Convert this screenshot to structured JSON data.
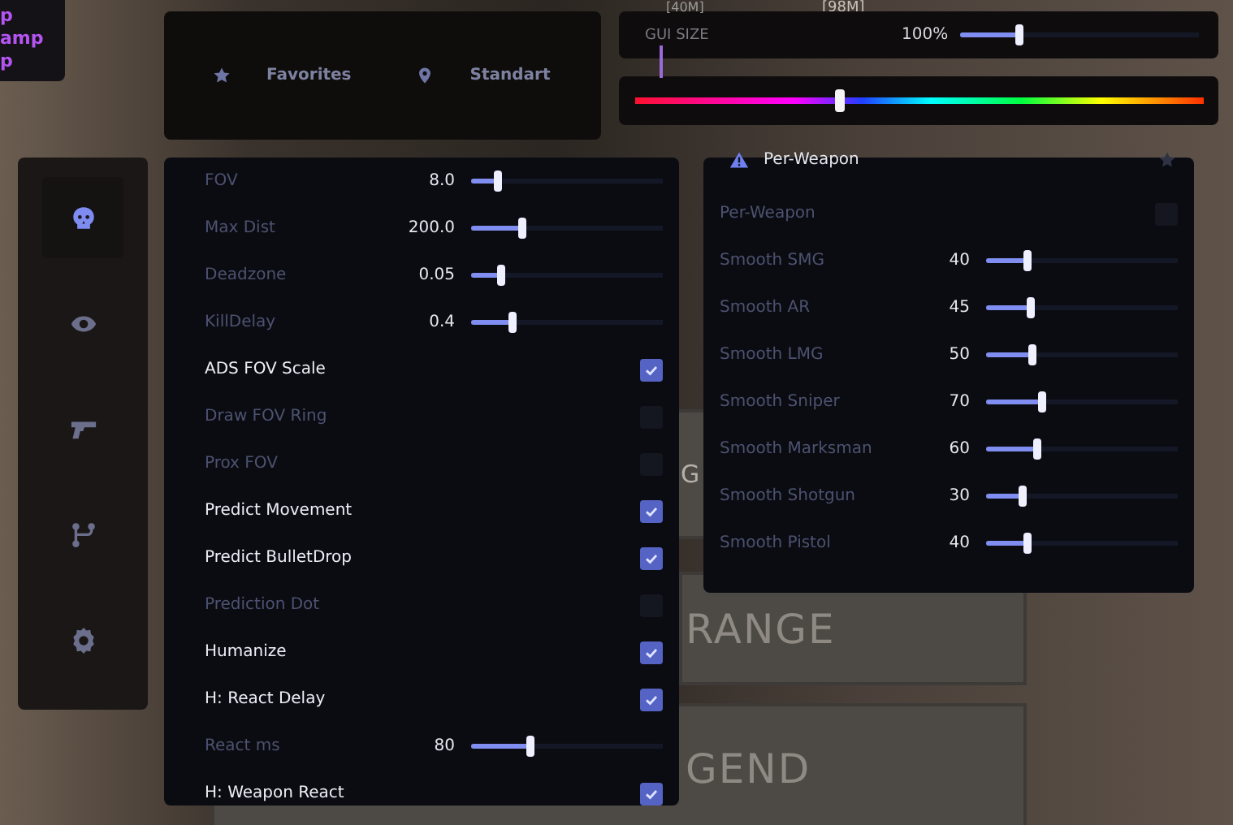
{
  "scene": {
    "distance_top": "[98M]",
    "distance_mid": "[40M]",
    "signs": [
      "G",
      "RANGE",
      "GEND"
    ]
  },
  "overlay_list": [
    "p",
    "amp",
    "p"
  ],
  "quick_bar": [
    {
      "label": "Favorites"
    },
    {
      "label": "Standart"
    }
  ],
  "gui_size": {
    "label": "GUI SIZE",
    "reading": "100%",
    "level": 0.24
  },
  "color_picker": {
    "level": 0.36
  },
  "sidebar": [
    {
      "selected": true
    },
    {
      "selected": false
    },
    {
      "selected": false
    },
    {
      "selected": false
    },
    {
      "selected": false
    }
  ],
  "settings": [
    {
      "kind": "slider",
      "label": "FOV",
      "reading": "8.0",
      "level": 0.13
    },
    {
      "kind": "slider",
      "label": "Max Dist",
      "reading": "200.0",
      "level": 0.25
    },
    {
      "kind": "slider",
      "label": "Deadzone",
      "reading": "0.05",
      "level": 0.14
    },
    {
      "kind": "slider",
      "label": "KillDelay",
      "reading": "0.4",
      "level": 0.2
    },
    {
      "kind": "checkbox",
      "label": "ADS FOV Scale",
      "checked": true
    },
    {
      "kind": "checkbox",
      "label": "Draw FOV Ring",
      "checked": false
    },
    {
      "kind": "checkbox",
      "label": "Prox FOV",
      "checked": false
    },
    {
      "kind": "checkbox",
      "label": "Predict Movement",
      "checked": true
    },
    {
      "kind": "checkbox",
      "label": "Predict BulletDrop",
      "checked": true
    },
    {
      "kind": "checkbox",
      "label": "Prediction Dot",
      "checked": false
    },
    {
      "kind": "checkbox",
      "label": "Humanize",
      "checked": true
    },
    {
      "kind": "checkbox",
      "label": "H: React Delay",
      "checked": true
    },
    {
      "kind": "slider",
      "label": "React ms",
      "reading": "80",
      "level": 0.3
    },
    {
      "kind": "checkbox",
      "label": "H: Weapon React",
      "checked": true
    }
  ],
  "per_weapon": {
    "title": "Per-Weapon",
    "rows": [
      {
        "kind": "checkbox",
        "label": "Per-Weapon",
        "checked": false
      },
      {
        "kind": "slider",
        "label": "Smooth SMG",
        "reading": "40",
        "level": 0.2
      },
      {
        "kind": "slider",
        "label": "Smooth AR",
        "reading": "45",
        "level": 0.22
      },
      {
        "kind": "slider",
        "label": "Smooth LMG",
        "reading": "50",
        "level": 0.23
      },
      {
        "kind": "slider",
        "label": "Smooth Sniper",
        "reading": "70",
        "level": 0.28
      },
      {
        "kind": "slider",
        "label": "Smooth Marksman",
        "reading": "60",
        "level": 0.25
      },
      {
        "kind": "slider",
        "label": "Smooth Shotgun",
        "reading": "30",
        "level": 0.18
      },
      {
        "kind": "slider",
        "label": "Smooth Pistol",
        "reading": "40",
        "level": 0.2
      }
    ]
  }
}
